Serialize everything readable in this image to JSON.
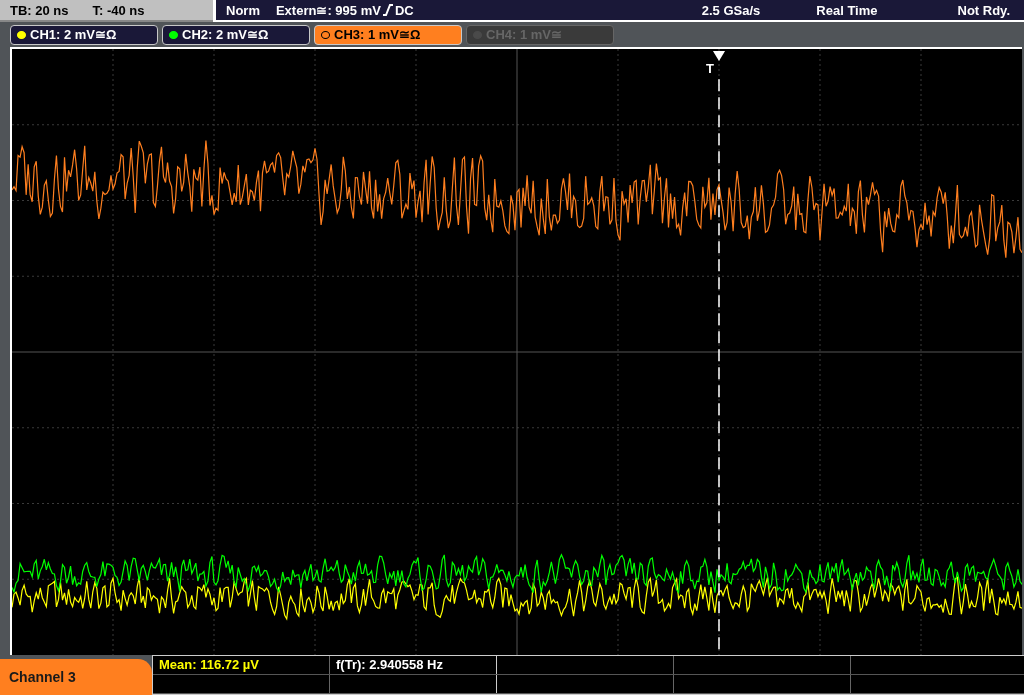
{
  "status_bar": {
    "timebase": "TB: 20 ns",
    "trigger_time": "T: -40 ns",
    "mode": "Norm",
    "trigger_source": "Extern≅: 995 mV",
    "coupling": "DC",
    "sample_rate": "2.5 GSa/s",
    "acquisition": "Real Time",
    "state": "Not Rdy."
  },
  "channels": [
    {
      "label": "CH1: 2 mV≅Ω",
      "color": "#ffff00",
      "on": true,
      "selected": false
    },
    {
      "label": "CH2: 2 mV≅Ω",
      "color": "#00ff00",
      "on": true,
      "selected": false
    },
    {
      "label": "CH3: 1 mV≅Ω",
      "color": "#ff7f1f",
      "on": true,
      "selected": true
    },
    {
      "label": "CH4: 1 mV≅",
      "color": "#4a4a4a",
      "on": false,
      "selected": false
    }
  ],
  "trigger": {
    "label": "T"
  },
  "panel_tab": {
    "label": "Channel 3"
  },
  "measurements": [
    {
      "text": "Mean: 116.72 µV",
      "kind": "amplitude"
    },
    {
      "text": "f(Tr): 2.940558 Hz",
      "kind": "timing"
    }
  ]
}
